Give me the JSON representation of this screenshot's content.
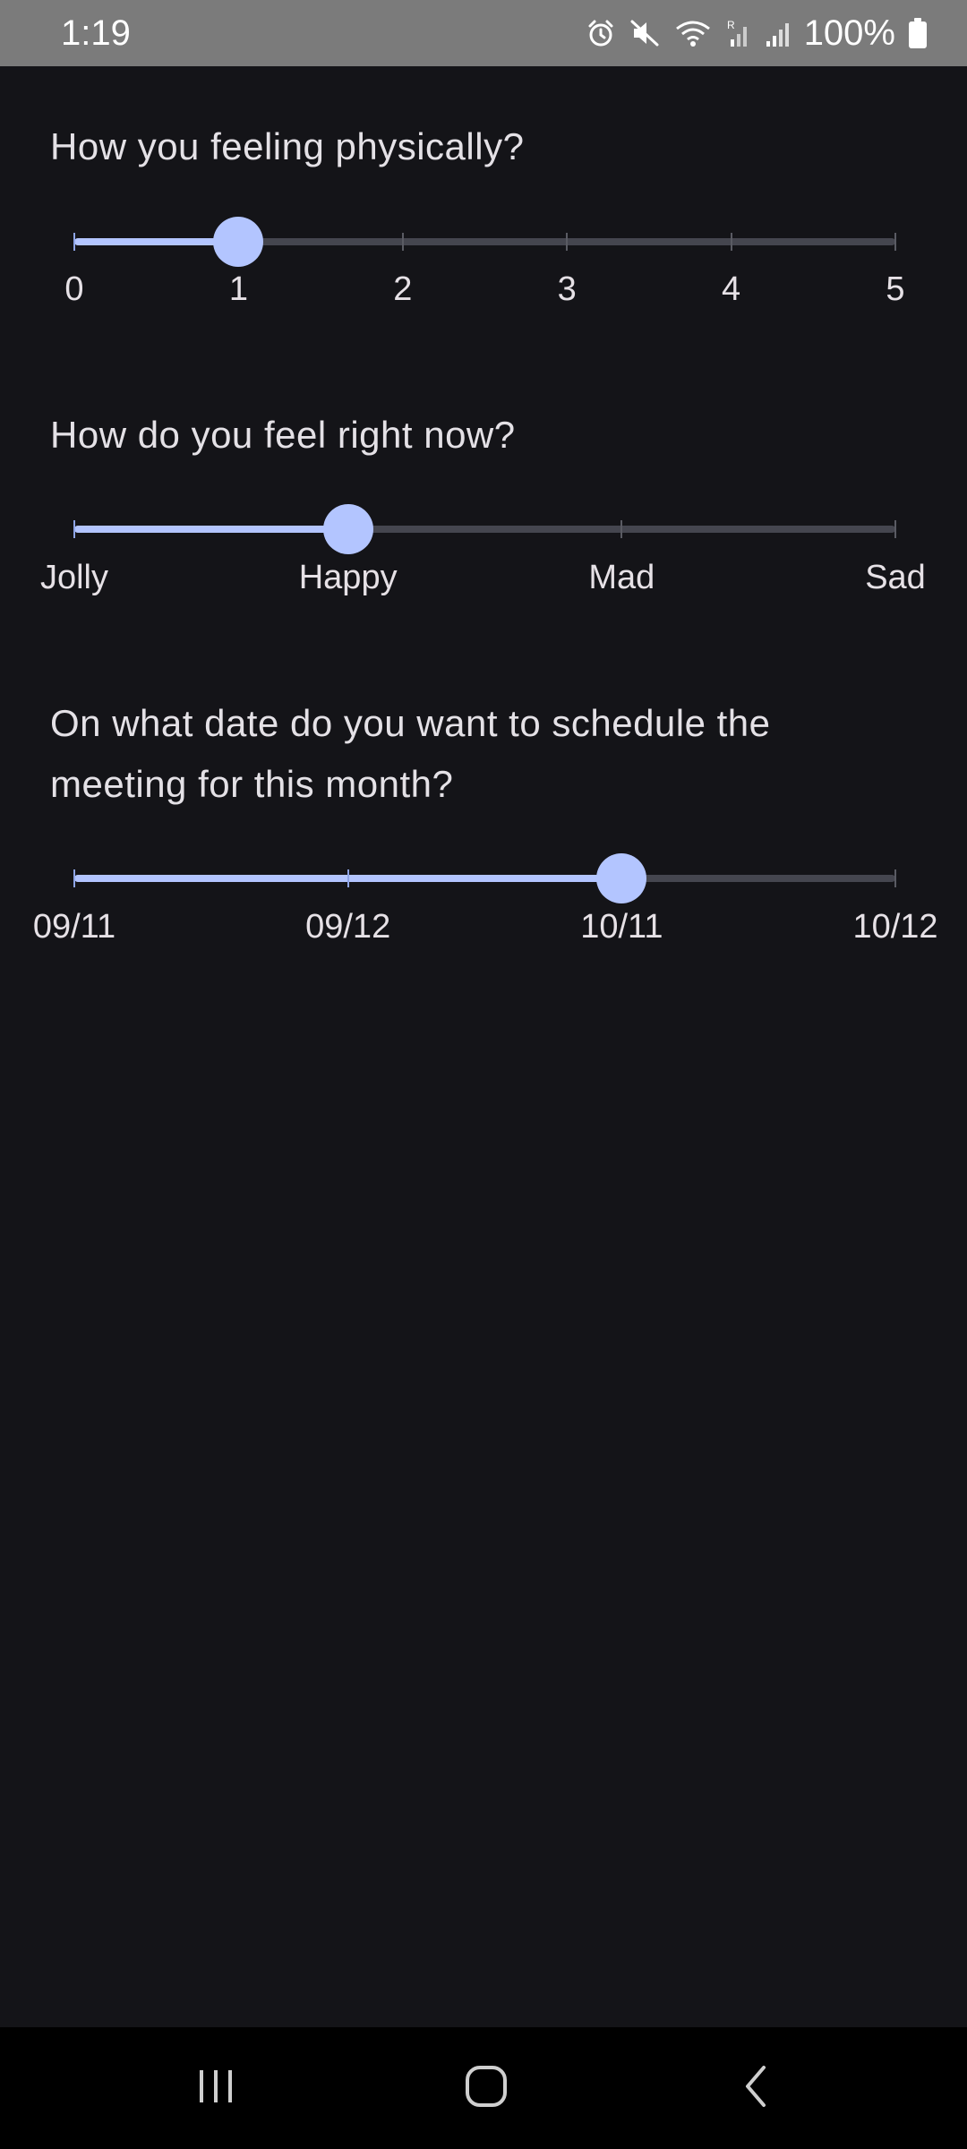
{
  "status_bar": {
    "time": "1:19",
    "battery": "100%",
    "icons": [
      "alarm-icon",
      "mute-icon",
      "wifi-icon",
      "signal-roaming-icon",
      "signal-icon",
      "battery-icon"
    ]
  },
  "sliders": [
    {
      "question": "How you feeling physically?",
      "labels": [
        "0",
        "1",
        "2",
        "3",
        "4",
        "5"
      ],
      "value": 1,
      "max_index": 5,
      "selected_label": "1"
    },
    {
      "question": "How do you feel right now?",
      "labels": [
        "Jolly",
        "Happy",
        "Mad",
        "Sad"
      ],
      "value": 1,
      "max_index": 3,
      "selected_label": "Happy"
    },
    {
      "question": "On what date do you want to schedule the meeting for this month?",
      "labels": [
        "09/11",
        "09/12",
        "10/11",
        "10/12"
      ],
      "value": 2,
      "max_index": 3,
      "selected_label": "10/11"
    }
  ],
  "colors": {
    "background": "#141418",
    "accent": "#b3c5ff",
    "inactive_track": "#45464f",
    "status_bar": "#7b7b7b",
    "nav_bar": "#000000"
  },
  "nav_bar": {
    "buttons": [
      "recent-apps-icon",
      "home-icon",
      "back-icon"
    ]
  }
}
